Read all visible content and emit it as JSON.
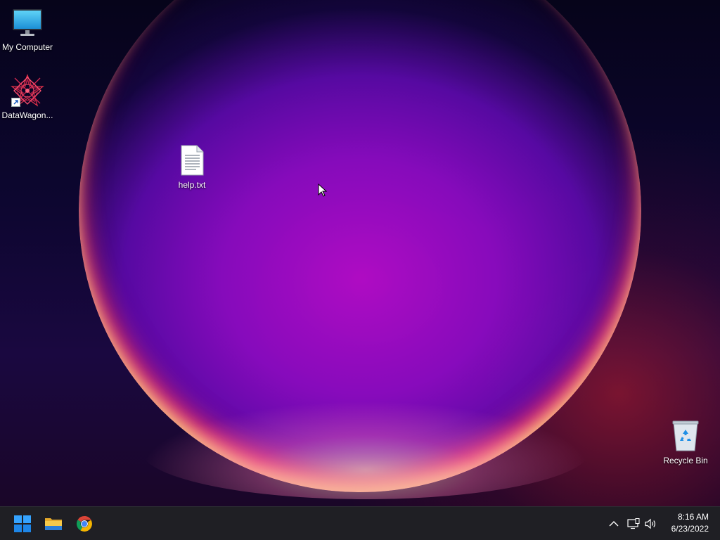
{
  "desktop": {
    "icons": [
      {
        "label": "My Computer",
        "icon": "monitor-icon"
      },
      {
        "label": "DataWagon...",
        "icon": "datawagon-app-icon"
      },
      {
        "label": "help.txt",
        "icon": "text-file-icon"
      },
      {
        "label": "Recycle Bin",
        "icon": "recycle-bin-icon"
      }
    ]
  },
  "taskbar": {
    "apps": [
      {
        "name": "start",
        "icon": "windows-start-icon"
      },
      {
        "name": "file-explorer",
        "icon": "folder-icon"
      },
      {
        "name": "chrome",
        "icon": "chrome-icon"
      }
    ],
    "tray": {
      "icons": [
        "chevron-up-icon",
        "network-icon",
        "volume-icon"
      ],
      "time": "8:16 AM",
      "date": "6/23/2022"
    }
  },
  "colors": {
    "taskbar_bg": "#1f1f24",
    "accent_blue": "#1e90ff",
    "folder_yellow": "#f2c14e"
  }
}
